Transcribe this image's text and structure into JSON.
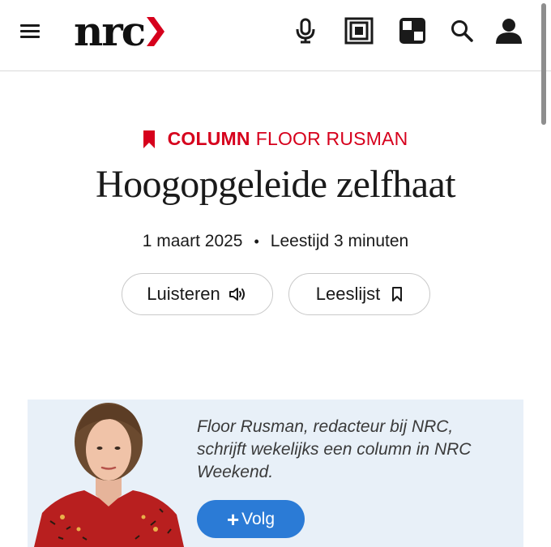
{
  "header": {
    "logo_text": "nrc",
    "menu_icon": "hamburger-menu-icon",
    "icons": [
      "microphone-icon",
      "newspaper-icon",
      "puzzles-grid-icon",
      "search-icon",
      "account-icon"
    ]
  },
  "article": {
    "rubric": "COLUMN",
    "author": "FLOOR RUSMAN",
    "title": "Hoogopgeleide zelfhaat",
    "date": "1 maart 2025",
    "separator": "•",
    "reading_time": "Leestijd 3 minuten",
    "listen_label": "Luisteren",
    "readlist_label": "Leeslijst"
  },
  "author_box": {
    "bio": "Floor Rusman, redacteur bij NRC, schrijft wekelijks een column in NRC Weekend.",
    "follow_plus": "+",
    "follow_label": "Volg"
  },
  "colors": {
    "brand_red": "#d6001c",
    "follow_blue": "#2b7bd6",
    "author_box_bg": "#e8f0f8"
  }
}
